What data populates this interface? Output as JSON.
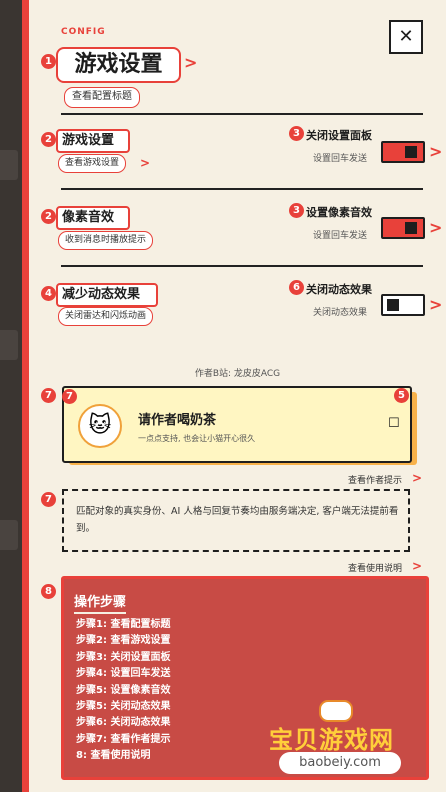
{
  "header": {
    "config_label": "CONFIG",
    "close_icon": "✕",
    "title": "游戏设置",
    "title_pill": "查看配置标题"
  },
  "rows": [
    {
      "num": "2",
      "left_title": "游戏设置",
      "left_pill": "查看游戏设置",
      "right_num": "3",
      "right_title": "关闭设置面板",
      "right_sub": "设置回车发送",
      "toggle_on": true
    },
    {
      "num": "2",
      "left_title": "像素音效",
      "left_pill": "收到消息时播放提示",
      "right_num": "3",
      "right_title": "设置像素音效",
      "right_sub": "设置回车发送",
      "toggle_on": true
    },
    {
      "num": "4",
      "left_title": "减少动态效果",
      "left_pill": "关闭雷达和闪烁动画",
      "right_num": "6",
      "right_title": "关闭动态效果",
      "right_sub": "关闭动态效果",
      "toggle_on": false
    }
  ],
  "author_line": "作者B站: 龙皮皮ACG",
  "card": {
    "num_left": "7",
    "num_right": "5",
    "avatar_icon": "cat-face-icon",
    "avatar_glyph": "🐱",
    "title": "请作者喝奶茶",
    "subtitle": "一点点支持, 也会让小猫开心很久",
    "check_glyph": "☐"
  },
  "hint_link": "查看作者提示",
  "notice": {
    "num": "7",
    "text": "匹配对象的真实身份、AI 人格与回复节奏均由服务端决定, 客户端无法提前看到。"
  },
  "usage_link": "查看使用说明",
  "steps": {
    "num": "8",
    "title": "操作步骤",
    "items": [
      "步骤1: 查看配置标题",
      "步骤2: 查看游戏设置",
      "步骤3: 关闭设置面板",
      "步骤4: 设置回车发送",
      "步骤5: 设置像素音效",
      "步骤5: 关闭动态效果",
      "步骤6: 关闭动态效果",
      "步骤7: 查看作者提示",
      "8: 查看使用说明"
    ]
  },
  "watermark": {
    "title": "宝贝游戏网",
    "url": "baobeiy.com"
  },
  "colors": {
    "accent": "#e8413a",
    "panel_bg": "#f6f0e3",
    "card_bg": "#fff6c2",
    "steps_bg": "#c84b45"
  }
}
